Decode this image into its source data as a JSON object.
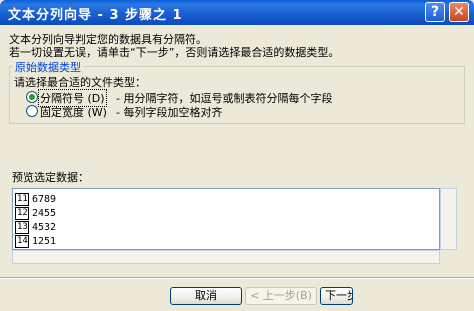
{
  "window": {
    "title": "文本分列向导 - 3 步骤之 1",
    "help_glyph": "?",
    "close_glyph": "✕"
  },
  "intro": {
    "line1": "文本分列向导判定您的数据具有分隔符。",
    "line2": "若一切设置无误，请单击“下一步”，否则请选择最合适的数据类型。"
  },
  "group": {
    "title": "原始数据类型",
    "prompt": "请选择最合适的文件类型：",
    "options": [
      {
        "label": "分隔符号 (D)",
        "description": "- 用分隔字符，如逗号或制表符分隔每个字段",
        "selected": true
      },
      {
        "label": "固定宽度 (W)",
        "description": "- 每列字段加空格对齐",
        "selected": false
      }
    ]
  },
  "preview": {
    "label": "预览选定数据：",
    "rows": [
      {
        "num": "11",
        "value": "6789"
      },
      {
        "num": "12",
        "value": "2455"
      },
      {
        "num": "13",
        "value": "4532"
      },
      {
        "num": "14",
        "value": "1251"
      }
    ]
  },
  "buttons": {
    "cancel": "取消",
    "back": "< 上一步(B)",
    "next": "下一步"
  },
  "colors": {
    "titlebar": "#0b4bc0",
    "group_title": "#0046d5",
    "radio_selected": "#21a121",
    "dialog_bg": "#ece9d8"
  }
}
